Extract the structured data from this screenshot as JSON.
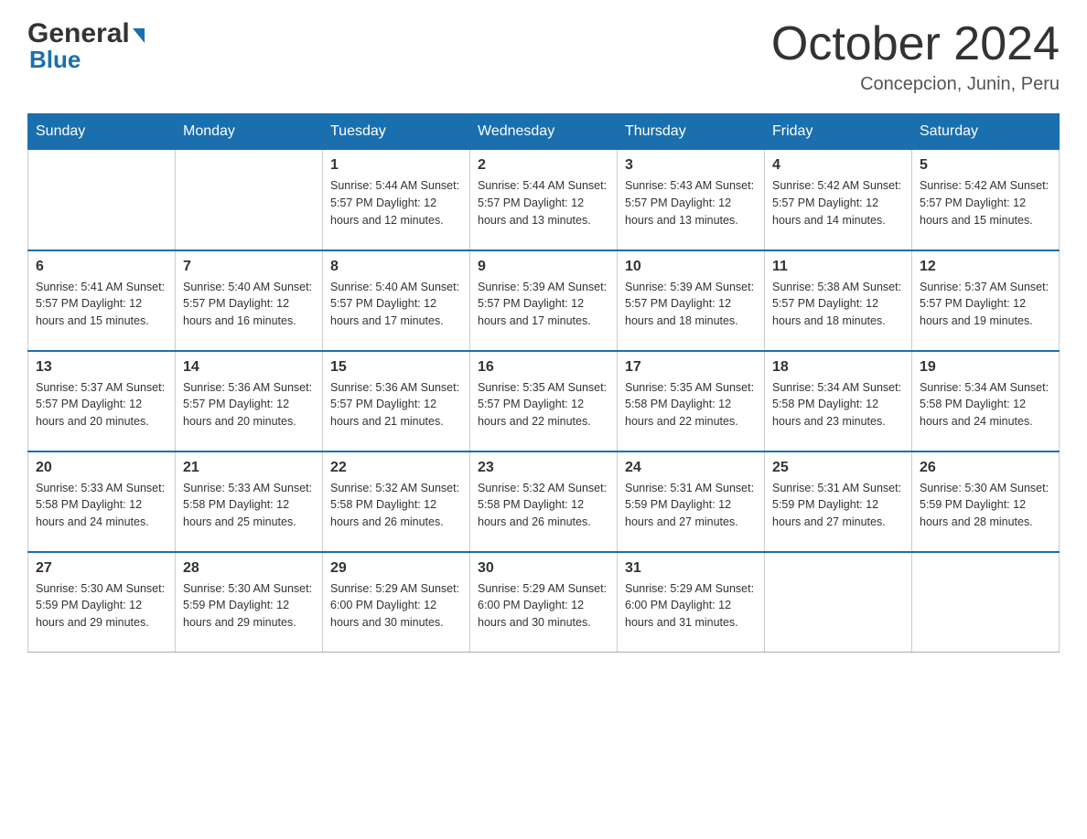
{
  "header": {
    "logo": {
      "general": "General",
      "blue": "Blue"
    },
    "title": "October 2024",
    "subtitle": "Concepcion, Junin, Peru"
  },
  "days": [
    "Sunday",
    "Monday",
    "Tuesday",
    "Wednesday",
    "Thursday",
    "Friday",
    "Saturday"
  ],
  "weeks": [
    [
      {
        "day": "",
        "info": ""
      },
      {
        "day": "",
        "info": ""
      },
      {
        "day": "1",
        "info": "Sunrise: 5:44 AM\nSunset: 5:57 PM\nDaylight: 12 hours\nand 12 minutes."
      },
      {
        "day": "2",
        "info": "Sunrise: 5:44 AM\nSunset: 5:57 PM\nDaylight: 12 hours\nand 13 minutes."
      },
      {
        "day": "3",
        "info": "Sunrise: 5:43 AM\nSunset: 5:57 PM\nDaylight: 12 hours\nand 13 minutes."
      },
      {
        "day": "4",
        "info": "Sunrise: 5:42 AM\nSunset: 5:57 PM\nDaylight: 12 hours\nand 14 minutes."
      },
      {
        "day": "5",
        "info": "Sunrise: 5:42 AM\nSunset: 5:57 PM\nDaylight: 12 hours\nand 15 minutes."
      }
    ],
    [
      {
        "day": "6",
        "info": "Sunrise: 5:41 AM\nSunset: 5:57 PM\nDaylight: 12 hours\nand 15 minutes."
      },
      {
        "day": "7",
        "info": "Sunrise: 5:40 AM\nSunset: 5:57 PM\nDaylight: 12 hours\nand 16 minutes."
      },
      {
        "day": "8",
        "info": "Sunrise: 5:40 AM\nSunset: 5:57 PM\nDaylight: 12 hours\nand 17 minutes."
      },
      {
        "day": "9",
        "info": "Sunrise: 5:39 AM\nSunset: 5:57 PM\nDaylight: 12 hours\nand 17 minutes."
      },
      {
        "day": "10",
        "info": "Sunrise: 5:39 AM\nSunset: 5:57 PM\nDaylight: 12 hours\nand 18 minutes."
      },
      {
        "day": "11",
        "info": "Sunrise: 5:38 AM\nSunset: 5:57 PM\nDaylight: 12 hours\nand 18 minutes."
      },
      {
        "day": "12",
        "info": "Sunrise: 5:37 AM\nSunset: 5:57 PM\nDaylight: 12 hours\nand 19 minutes."
      }
    ],
    [
      {
        "day": "13",
        "info": "Sunrise: 5:37 AM\nSunset: 5:57 PM\nDaylight: 12 hours\nand 20 minutes."
      },
      {
        "day": "14",
        "info": "Sunrise: 5:36 AM\nSunset: 5:57 PM\nDaylight: 12 hours\nand 20 minutes."
      },
      {
        "day": "15",
        "info": "Sunrise: 5:36 AM\nSunset: 5:57 PM\nDaylight: 12 hours\nand 21 minutes."
      },
      {
        "day": "16",
        "info": "Sunrise: 5:35 AM\nSunset: 5:57 PM\nDaylight: 12 hours\nand 22 minutes."
      },
      {
        "day": "17",
        "info": "Sunrise: 5:35 AM\nSunset: 5:58 PM\nDaylight: 12 hours\nand 22 minutes."
      },
      {
        "day": "18",
        "info": "Sunrise: 5:34 AM\nSunset: 5:58 PM\nDaylight: 12 hours\nand 23 minutes."
      },
      {
        "day": "19",
        "info": "Sunrise: 5:34 AM\nSunset: 5:58 PM\nDaylight: 12 hours\nand 24 minutes."
      }
    ],
    [
      {
        "day": "20",
        "info": "Sunrise: 5:33 AM\nSunset: 5:58 PM\nDaylight: 12 hours\nand 24 minutes."
      },
      {
        "day": "21",
        "info": "Sunrise: 5:33 AM\nSunset: 5:58 PM\nDaylight: 12 hours\nand 25 minutes."
      },
      {
        "day": "22",
        "info": "Sunrise: 5:32 AM\nSunset: 5:58 PM\nDaylight: 12 hours\nand 26 minutes."
      },
      {
        "day": "23",
        "info": "Sunrise: 5:32 AM\nSunset: 5:58 PM\nDaylight: 12 hours\nand 26 minutes."
      },
      {
        "day": "24",
        "info": "Sunrise: 5:31 AM\nSunset: 5:59 PM\nDaylight: 12 hours\nand 27 minutes."
      },
      {
        "day": "25",
        "info": "Sunrise: 5:31 AM\nSunset: 5:59 PM\nDaylight: 12 hours\nand 27 minutes."
      },
      {
        "day": "26",
        "info": "Sunrise: 5:30 AM\nSunset: 5:59 PM\nDaylight: 12 hours\nand 28 minutes."
      }
    ],
    [
      {
        "day": "27",
        "info": "Sunrise: 5:30 AM\nSunset: 5:59 PM\nDaylight: 12 hours\nand 29 minutes."
      },
      {
        "day": "28",
        "info": "Sunrise: 5:30 AM\nSunset: 5:59 PM\nDaylight: 12 hours\nand 29 minutes."
      },
      {
        "day": "29",
        "info": "Sunrise: 5:29 AM\nSunset: 6:00 PM\nDaylight: 12 hours\nand 30 minutes."
      },
      {
        "day": "30",
        "info": "Sunrise: 5:29 AM\nSunset: 6:00 PM\nDaylight: 12 hours\nand 30 minutes."
      },
      {
        "day": "31",
        "info": "Sunrise: 5:29 AM\nSunset: 6:00 PM\nDaylight: 12 hours\nand 31 minutes."
      },
      {
        "day": "",
        "info": ""
      },
      {
        "day": "",
        "info": ""
      }
    ]
  ]
}
